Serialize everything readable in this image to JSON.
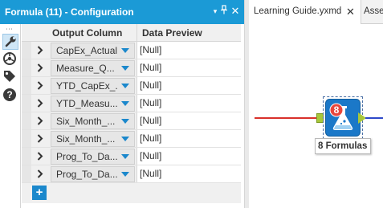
{
  "config_panel": {
    "title": "Formula (11) - Configuration",
    "header_buttons": {
      "dropdown": "▾",
      "pin": "⊥",
      "close": "✕"
    },
    "side_tools": [
      "wrench-icon",
      "wheel-icon",
      "tag-icon",
      "help-icon"
    ],
    "columns": {
      "output": "Output Column",
      "preview": "Data Preview"
    },
    "rows": [
      {
        "name": "CapEx_Actual",
        "preview": "[Null]"
      },
      {
        "name": "Measure_Q...",
        "preview": "[Null]"
      },
      {
        "name": "YTD_CapEx_...",
        "preview": "[Null]"
      },
      {
        "name": "YTD_Measu...",
        "preview": "[Null]"
      },
      {
        "name": "Six_Month_...",
        "preview": "[Null]"
      },
      {
        "name": "Six_Month_...",
        "preview": "[Null]"
      },
      {
        "name": "Prog_To_Da...",
        "preview": "[Null]"
      },
      {
        "name": "Prog_To_Da...",
        "preview": "[Null]"
      }
    ],
    "add_button": "+"
  },
  "tabs": [
    {
      "label": "Learning Guide.yxmd",
      "close": "✕",
      "active": true
    },
    {
      "label": "Asset",
      "active": false
    }
  ],
  "canvas": {
    "tool_badge": "8",
    "tool_annotation": "8 Formulas"
  },
  "colors": {
    "accent": "#1b9ad6",
    "input_connection": "#d9312b",
    "output_connection": "#2e49c9",
    "anchor": "#a8c83a",
    "tool_badge": "#e8463c"
  }
}
